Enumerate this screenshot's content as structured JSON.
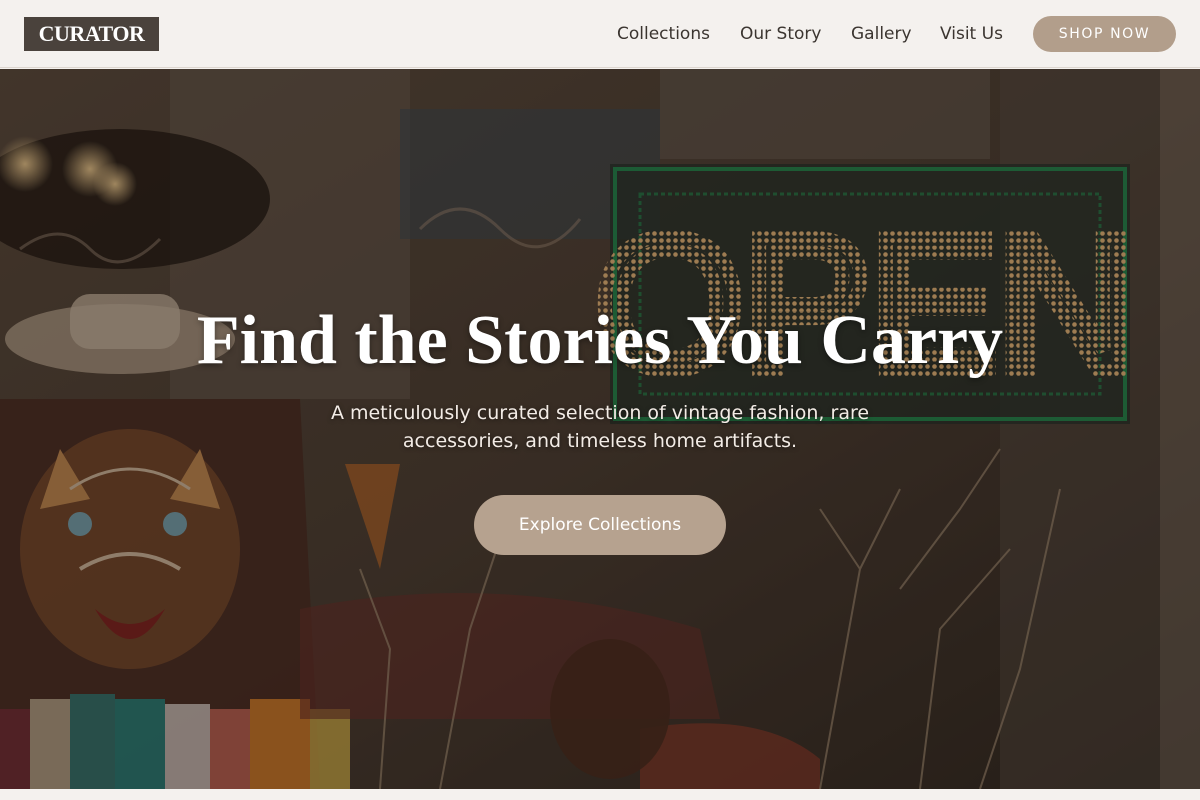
{
  "brand": {
    "logo_text": "CURATOR"
  },
  "nav": {
    "links": [
      {
        "label": "Collections"
      },
      {
        "label": "Our Story"
      },
      {
        "label": "Gallery"
      },
      {
        "label": "Visit Us"
      }
    ],
    "shop_button": "SHOP NOW"
  },
  "hero": {
    "title": "Find the Stories You Carry",
    "subtitle": "A meticulously curated selection of vintage fashion, rare accessories, and timeless home artifacts.",
    "cta_label": "Explore Collections",
    "background_sign": "OPEN"
  },
  "colors": {
    "accent": "#b29e8b",
    "logo_bg": "#4a423c",
    "nav_bg": "#f4f1ee",
    "text_dark": "#3b3530"
  }
}
